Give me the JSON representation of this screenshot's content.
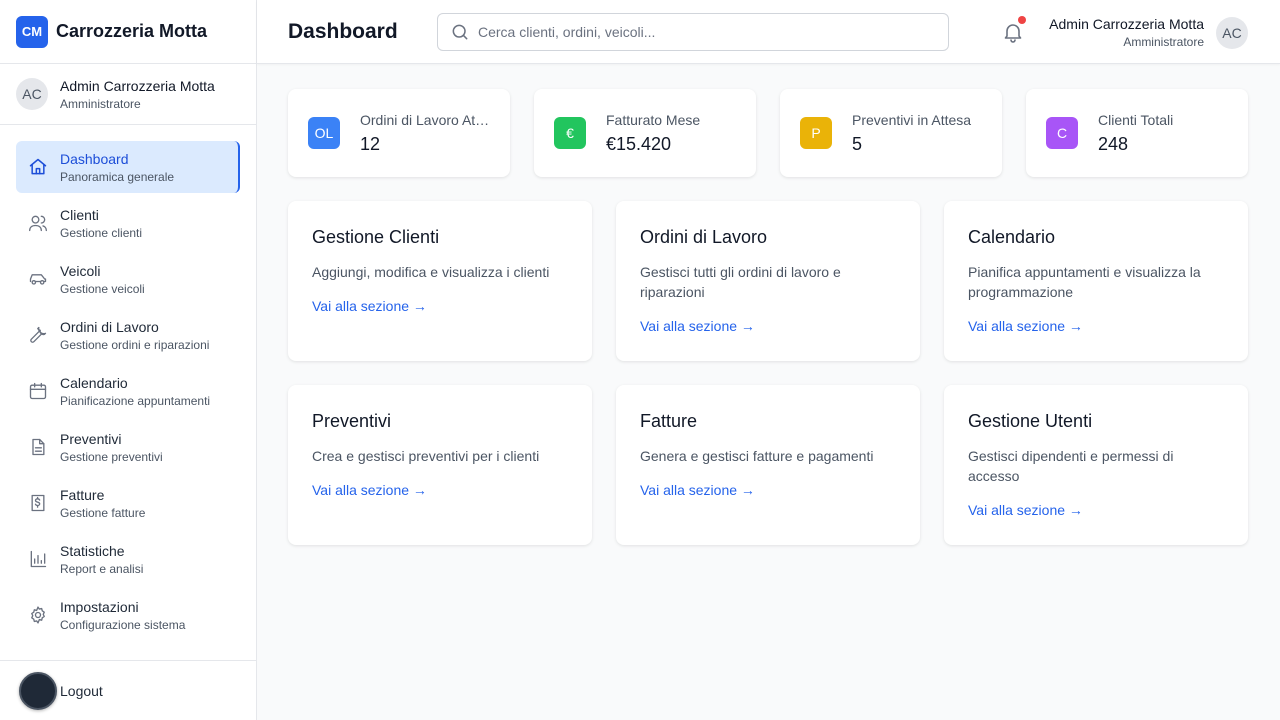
{
  "brand": {
    "logo": "CM",
    "name": "Carrozzeria Motta"
  },
  "user": {
    "name": "Admin Carrozzeria Motta",
    "role": "Amministratore",
    "initials": "AC"
  },
  "sidebar": {
    "items": [
      {
        "label": "Dashboard",
        "sub": "Panoramica generale",
        "icon": "home-icon"
      },
      {
        "label": "Clienti",
        "sub": "Gestione clienti",
        "icon": "users-icon"
      },
      {
        "label": "Veicoli",
        "sub": "Gestione veicoli",
        "icon": "car-icon"
      },
      {
        "label": "Ordini di Lavoro",
        "sub": "Gestione ordini e riparazioni",
        "icon": "wrench-icon"
      },
      {
        "label": "Calendario",
        "sub": "Pianificazione appuntamenti",
        "icon": "calendar-icon"
      },
      {
        "label": "Preventivi",
        "sub": "Gestione preventivi",
        "icon": "document-icon"
      },
      {
        "label": "Fatture",
        "sub": "Gestione fatture",
        "icon": "invoice-icon"
      },
      {
        "label": "Statistiche",
        "sub": "Report e analisi",
        "icon": "bar-chart-icon"
      },
      {
        "label": "Impostazioni",
        "sub": "Configurazione sistema",
        "icon": "gear-icon"
      }
    ],
    "active_index": 0,
    "logout": "Logout"
  },
  "header": {
    "title": "Dashboard",
    "search_placeholder": "Cerca clienti, ordini, veicoli..."
  },
  "stats": [
    {
      "badge": "OL",
      "label": "Ordini di Lavoro Attivi",
      "value": "12",
      "color": "#3b82f6"
    },
    {
      "badge": "€",
      "label": "Fatturato Mese",
      "value": "€15.420",
      "color": "#22c55e"
    },
    {
      "badge": "P",
      "label": "Preventivi in Attesa",
      "value": "5",
      "color": "#eab308"
    },
    {
      "badge": "C",
      "label": "Clienti Totali",
      "value": "248",
      "color": "#a855f7"
    }
  ],
  "sections": [
    {
      "title": "Gestione Clienti",
      "desc": "Aggiungi, modifica e visualizza i clienti",
      "link": "Vai alla sezione →"
    },
    {
      "title": "Ordini di Lavoro",
      "desc": "Gestisci tutti gli ordini di lavoro e riparazioni",
      "link": "Vai alla sezione →"
    },
    {
      "title": "Calendario",
      "desc": "Pianifica appuntamenti e visualizza la programmazione",
      "link": "Vai alla sezione →"
    },
    {
      "title": "Preventivi",
      "desc": "Crea e gestisci preventivi per i clienti",
      "link": "Vai alla sezione →"
    },
    {
      "title": "Fatture",
      "desc": "Genera e gestisci fatture e pagamenti",
      "link": "Vai alla sezione →"
    },
    {
      "title": "Gestione Utenti",
      "desc": "Gestisci dipendenti e permessi di accesso",
      "link": "Vai alla sezione →"
    }
  ],
  "colors": {
    "accent": "#2563eb",
    "notification": "#ef4444"
  }
}
